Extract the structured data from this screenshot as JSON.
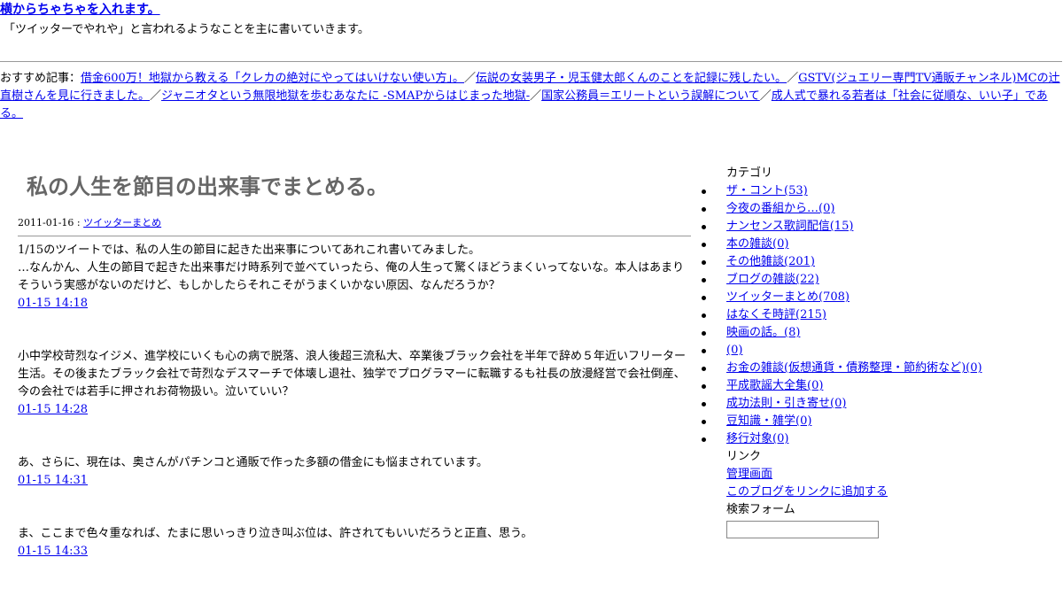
{
  "header": {
    "title": "横からちゃちゃを入れます。",
    "description": "「ツイッターでやれや」と言われるようなことを主に書いていきます。"
  },
  "recommend": {
    "label": "おすすめ記事：",
    "separator": "／",
    "links": [
      "借金600万！地獄から教える「クレカの絶対にやってはいけない使い方」。",
      "伝説の女装男子・児玉健太郎くんのことを記録に残したい。",
      "GSTV(ジュエリー専門TV通販チャンネル)MCの辻直樹さんを見に行きました。",
      "ジャニオタという無限地獄を歩むあなたに -SMAPからはじまった地獄-",
      "国家公務員＝エリートという誤解について",
      "成人式で暴れる若者は「社会に従順な、いい子」である。"
    ]
  },
  "entry": {
    "title": "私の人生を節目の出来事でまとめる。",
    "date": "2011-01-16 : ",
    "category": "ツイッターまとめ",
    "tweets": [
      {
        "text": "1/15のツイートでは、私の人生の節目に起きた出来事についてあれこれ書いてみました。\n…なんかん、人生の節目で起きた出来事だけ時系列で並べていったら、俺の人生って驚くほどうまくいってないな。本人はあまりそういう実感がないのだけど、もしかしたらそれこそがうまくいかない原因、なんだろうか？",
        "time": "01-15 14:18"
      },
      {
        "text": "小中学校苛烈なイジメ、進学校にいくも心の病で脱落、浪人後超三流私大、卒業後ブラック会社を半年で辞め５年近いフリーター生活。その後またブラック会社で苛烈なデスマーチで体壊し退社、独学でプログラマーに転職するも社長の放漫経営で会社倒産、今の会社では若手に押されお荷物扱い。泣いていい？",
        "time": "01-15 14:28"
      },
      {
        "text": "あ、さらに、現在は、奥さんがパチンコと通販で作った多額の借金にも悩まされています。",
        "time": "01-15 14:31"
      },
      {
        "text": "ま、ここまで色々重なれば、たまに思いっきり泣き叫ぶ位は、許されてもいいだろうと正直、思う。",
        "time": "01-15 14:33"
      }
    ]
  },
  "sidebar": {
    "category_heading": "カテゴリ",
    "categories": [
      "ザ・コント(53)",
      "今夜の番組から…(0)",
      "ナンセンス歌詞配信(15)",
      "本の雑談(0)",
      "その他雑談(201)",
      "ブログの雑談(22)",
      "ツイッターまとめ(708)",
      "はなくそ時評(215)",
      "映画の話。(8)",
      "(0)",
      "お金の雑談(仮想通貨・債務整理・節約術など)(0)",
      "平成歌謡大全集(0)",
      "成功法則・引き寄せ(0)",
      "豆知識・雑学(0)",
      "移行対象(0)"
    ],
    "link_heading": "リンク",
    "links": [
      "管理画面",
      "このブログをリンクに追加する"
    ],
    "search_heading": "検索フォーム"
  }
}
